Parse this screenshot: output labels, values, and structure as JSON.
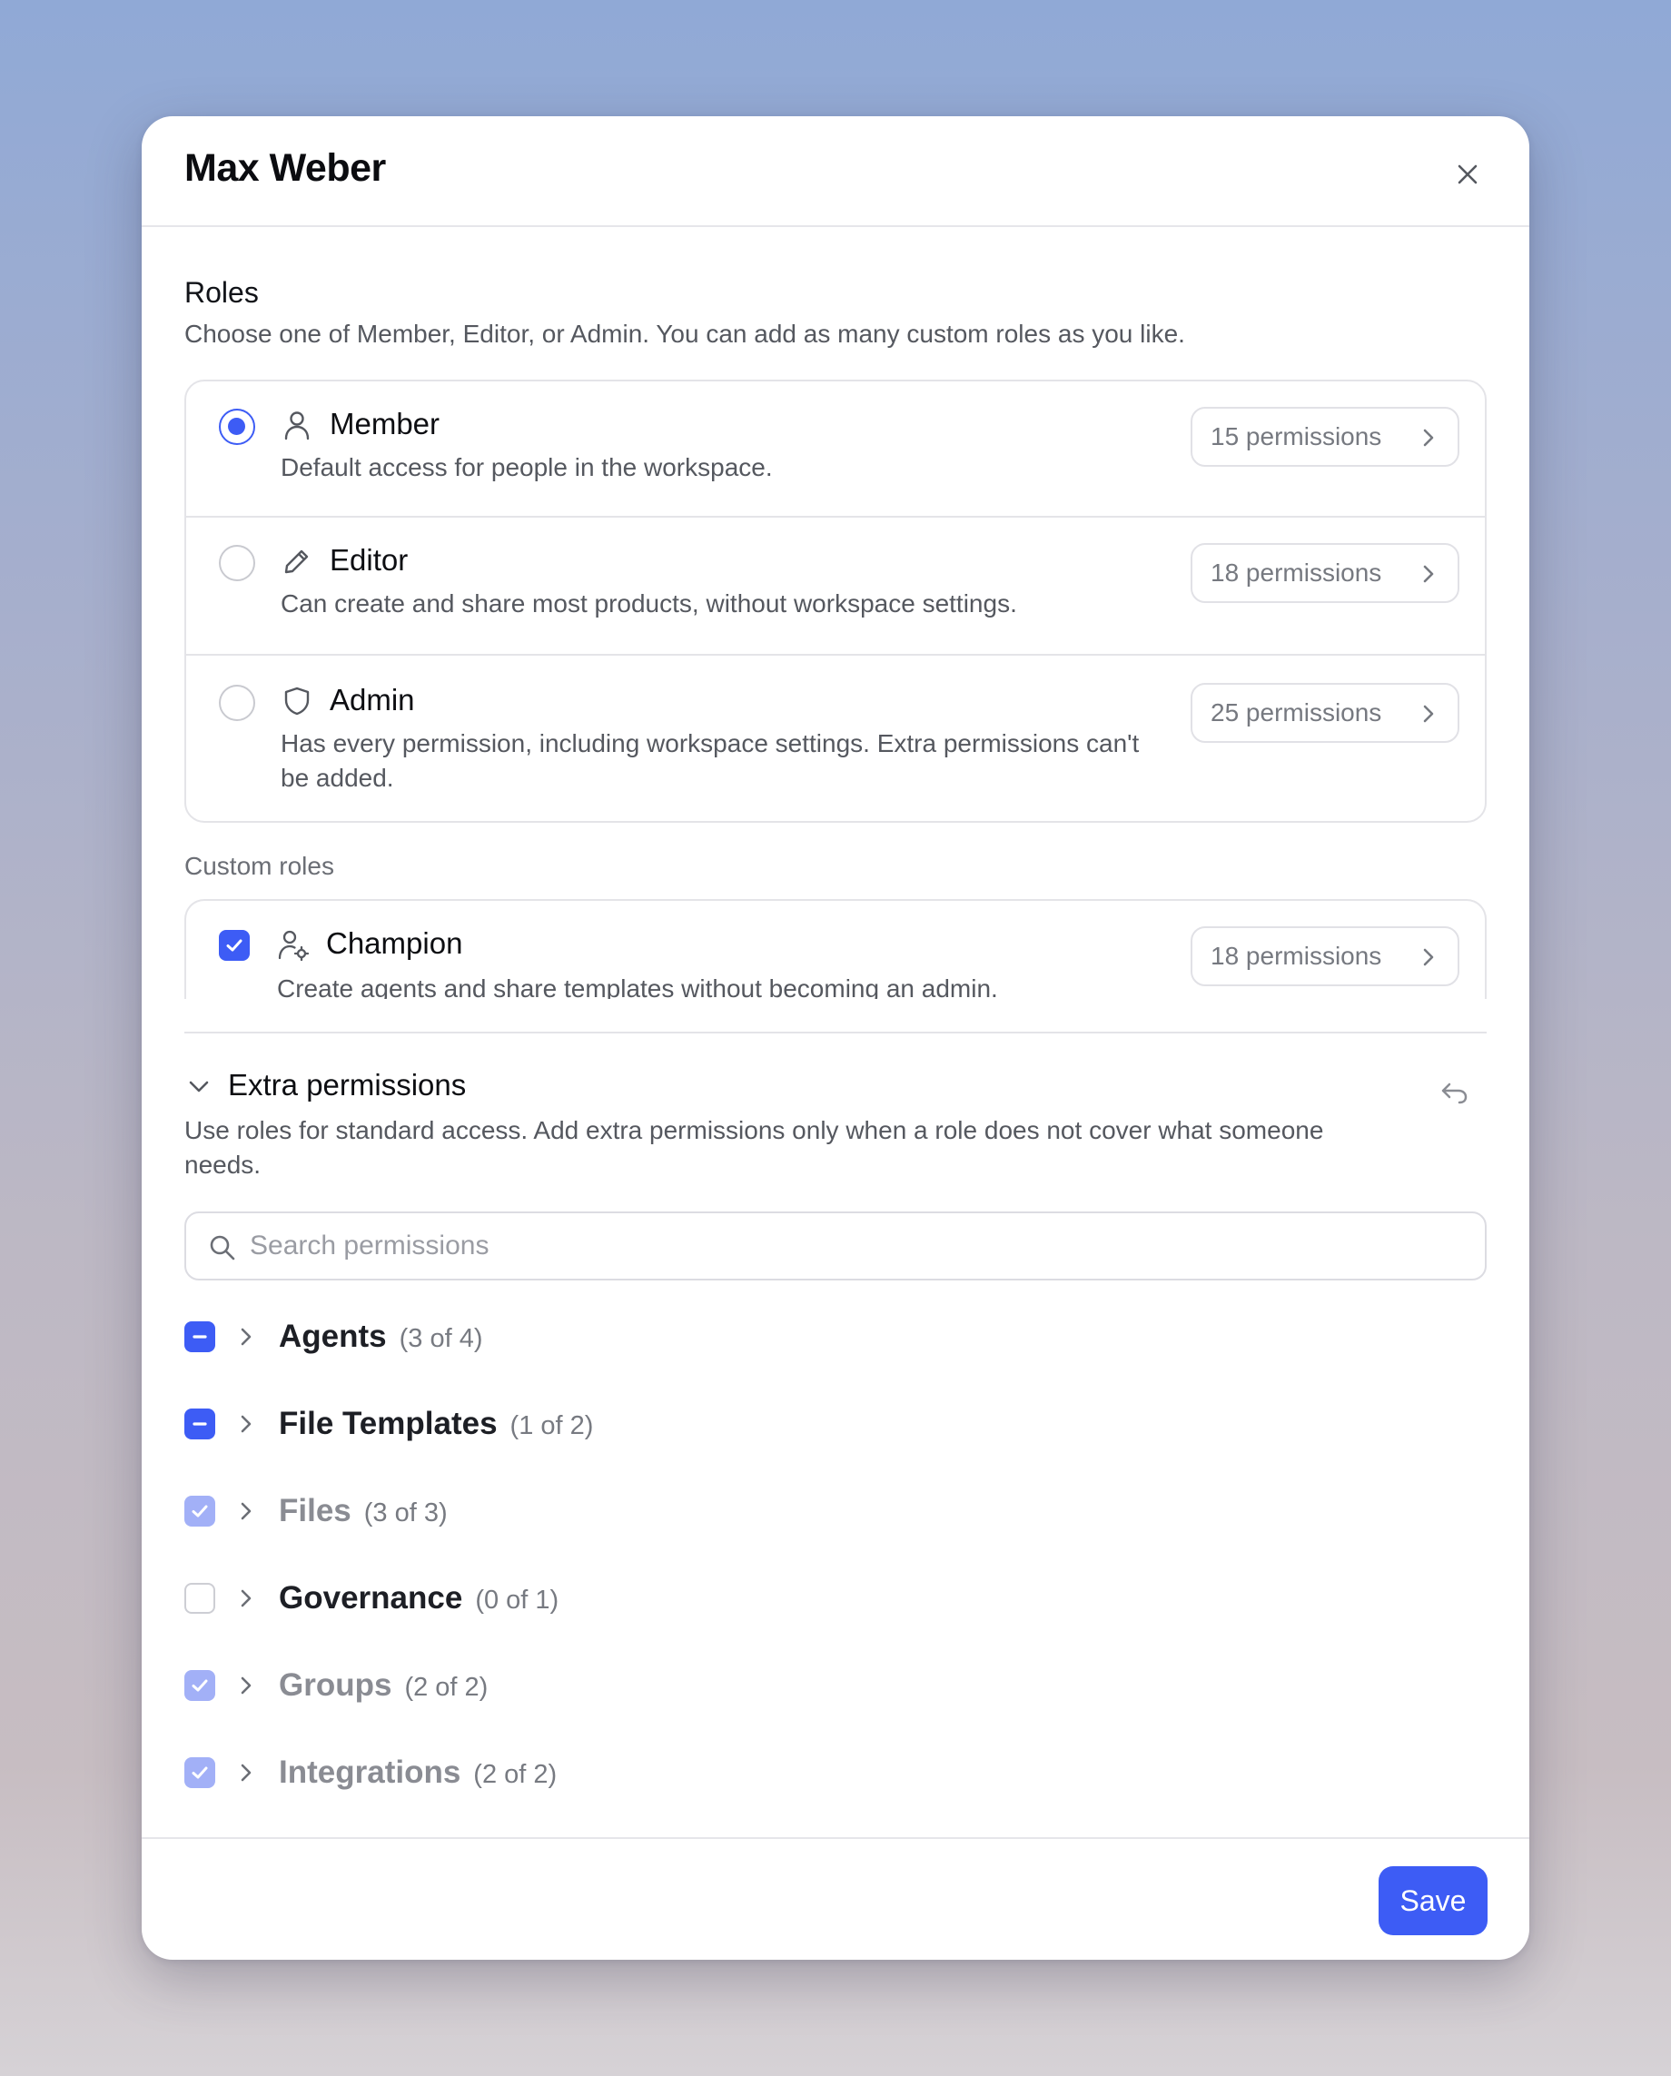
{
  "modal": {
    "title": "Max Weber"
  },
  "roles": {
    "title": "Roles",
    "description": "Choose one of Member, Editor, or Admin. You can add as many custom roles as you like.",
    "items": [
      {
        "name": "Member",
        "description": "Default access for people in the workspace.",
        "permissions": "15 permissions",
        "selected": true,
        "icon": "user-icon"
      },
      {
        "name": "Editor",
        "description": "Can create and share most products, without workspace settings.",
        "permissions": "18 permissions",
        "selected": false,
        "icon": "pencil-icon"
      },
      {
        "name": "Admin",
        "description": "Has every permission, including workspace settings. Extra permissions can't be added.",
        "permissions": "25 permissions",
        "selected": false,
        "icon": "shield-icon"
      }
    ]
  },
  "custom_roles": {
    "label": "Custom roles",
    "items": [
      {
        "name": "Champion",
        "description": "Create agents and share templates without becoming an admin.",
        "permissions": "18 permissions",
        "checked": true,
        "icon": "user-gear-icon"
      }
    ]
  },
  "extra_permissions": {
    "title": "Extra permissions",
    "description": "Use roles for standard access. Add extra permissions only when a role does not cover what someone needs.",
    "search_placeholder": "Search permissions",
    "groups": [
      {
        "name": "Agents",
        "count": "(3 of 4)",
        "state": "partial"
      },
      {
        "name": "File Templates",
        "count": "(1 of 2)",
        "state": "partial"
      },
      {
        "name": "Files",
        "count": "(3 of 3)",
        "state": "inherited"
      },
      {
        "name": "Governance",
        "count": "(0 of 1)",
        "state": "unchecked"
      },
      {
        "name": "Groups",
        "count": "(2 of 2)",
        "state": "inherited"
      },
      {
        "name": "Integrations",
        "count": "(2 of 2)",
        "state": "inherited"
      }
    ]
  },
  "footer": {
    "save_label": "Save"
  },
  "colors": {
    "accent": "#3d5cf5",
    "accent_dim": "#a2b0f7",
    "border": "#e4e4e8"
  }
}
